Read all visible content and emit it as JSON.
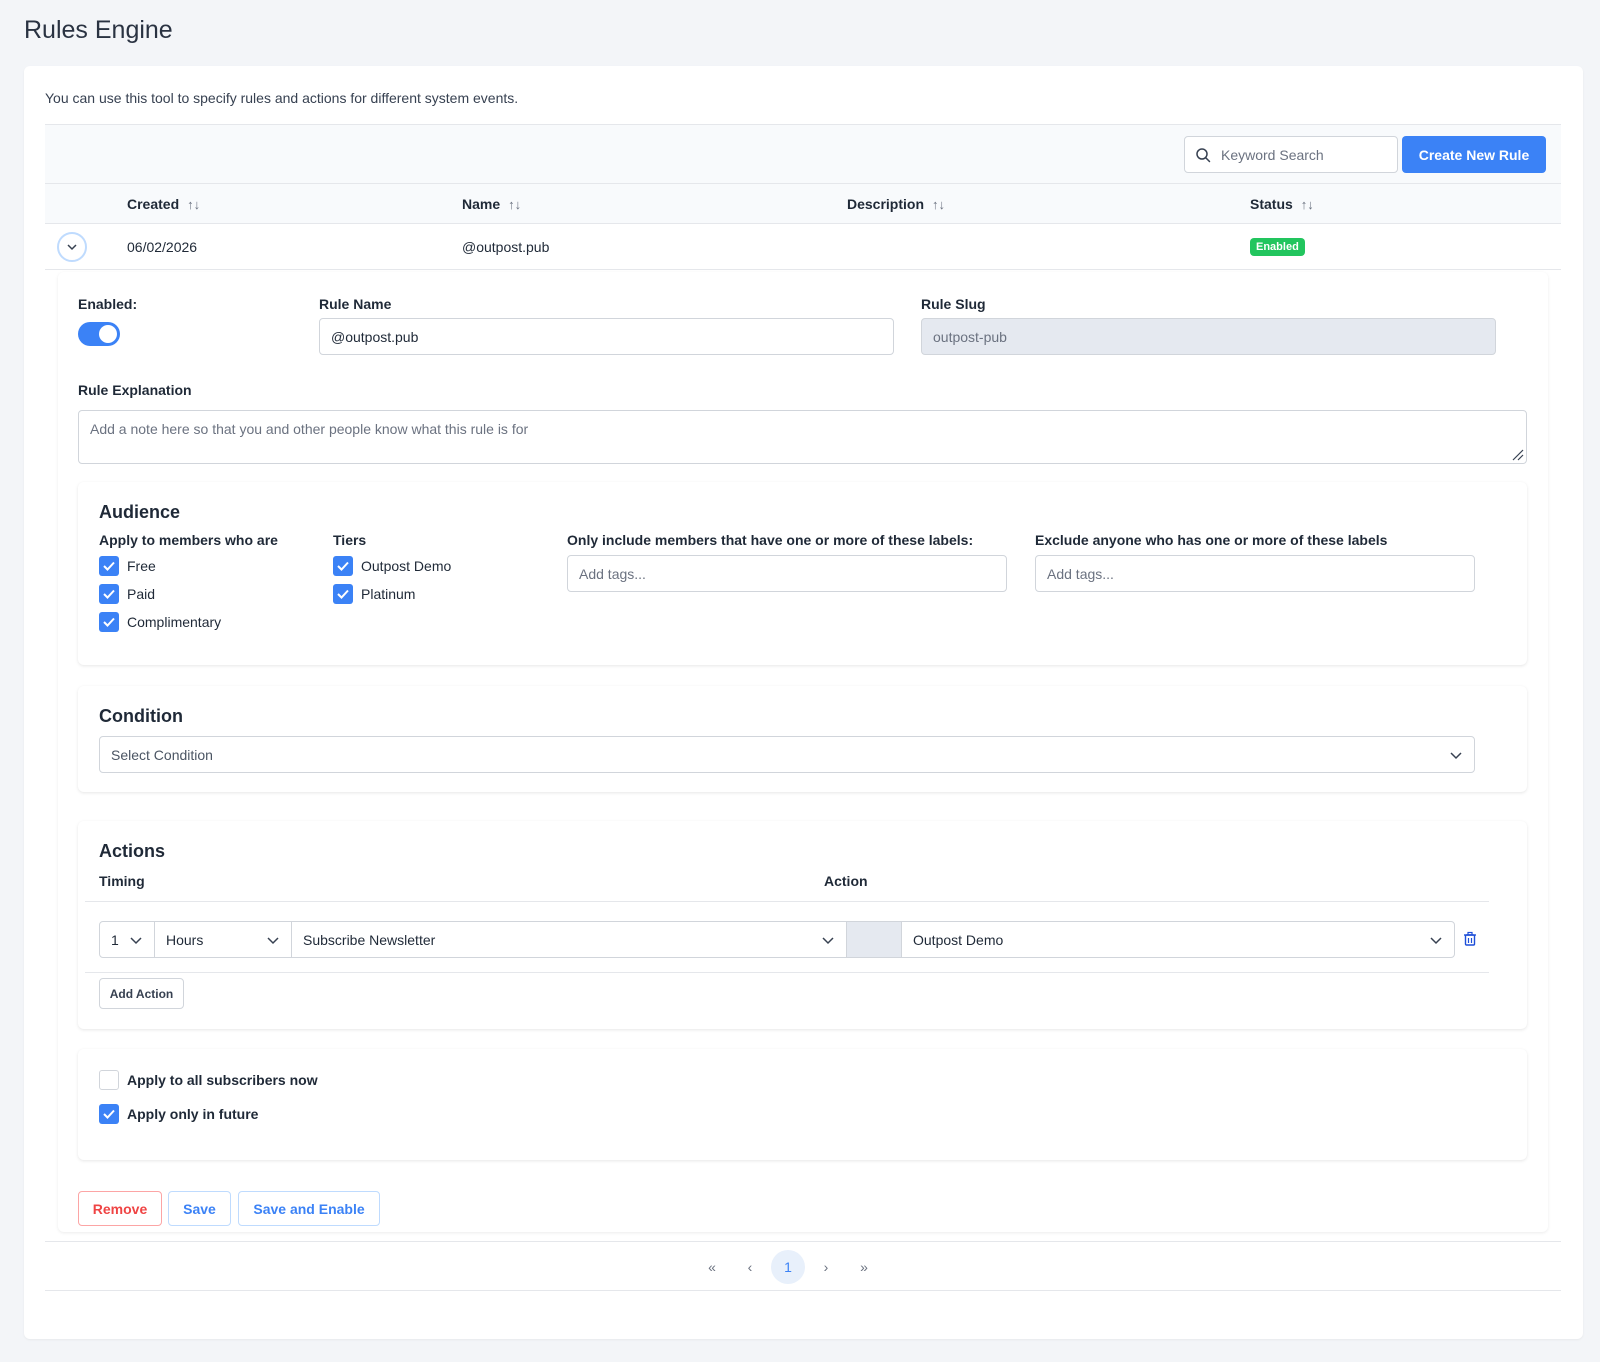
{
  "page": {
    "title": "Rules Engine"
  },
  "intro": "You can use this tool to specify rules and actions for different system events.",
  "toolbar": {
    "search_placeholder": "Keyword Search",
    "create_label": "Create New Rule"
  },
  "table": {
    "columns": [
      "Created",
      "Name",
      "Description",
      "Status"
    ],
    "rows": [
      {
        "created": "06/02/2026",
        "name": "@outpost.pub",
        "description": "",
        "status": "Enabled"
      }
    ]
  },
  "detail": {
    "enabled_label": "Enabled:",
    "enabled": true,
    "rule_name_label": "Rule Name",
    "rule_name_value": "@outpost.pub",
    "rule_slug_label": "Rule Slug",
    "rule_slug_value": "outpost-pub",
    "explanation_label": "Rule Explanation",
    "explanation_placeholder": "Add a note here so that you and other people know what this rule is for",
    "audience": {
      "title": "Audience",
      "members_label": "Apply to members who are",
      "members": [
        {
          "label": "Free",
          "checked": true
        },
        {
          "label": "Paid",
          "checked": true
        },
        {
          "label": "Complimentary",
          "checked": true
        }
      ],
      "tiers_label": "Tiers",
      "tiers": [
        {
          "label": "Outpost Demo",
          "checked": true
        },
        {
          "label": "Platinum",
          "checked": true
        }
      ],
      "include_label": "Only include members that have one or more of these labels:",
      "include_placeholder": "Add tags...",
      "exclude_label": "Exclude anyone who has one or more of these labels",
      "exclude_placeholder": "Add tags..."
    },
    "condition": {
      "title": "Condition",
      "placeholder": "Select Condition"
    },
    "actions": {
      "title": "Actions",
      "timing_label": "Timing",
      "action_label": "Action",
      "row": {
        "amount": "1",
        "unit": "Hours",
        "action": "Subscribe Newsletter",
        "target": "Outpost Demo"
      },
      "add_label": "Add Action"
    },
    "apply": {
      "all_now": {
        "label": "Apply to all subscribers now",
        "checked": false
      },
      "future": {
        "label": "Apply only in future",
        "checked": true
      }
    },
    "buttons": {
      "remove": "Remove",
      "save": "Save",
      "save_enable": "Save and Enable"
    }
  },
  "pagination": {
    "current": "1"
  },
  "colors": {
    "primary": "#3b82f6",
    "success": "#22c55e",
    "danger": "#ef4444"
  }
}
